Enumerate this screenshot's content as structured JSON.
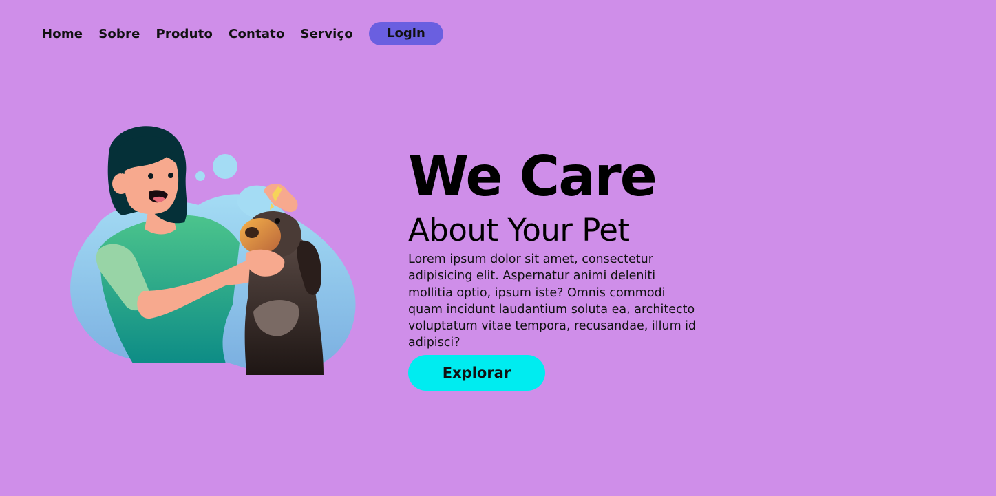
{
  "nav": {
    "links": [
      "Home",
      "Sobre",
      "Produto",
      "Contato",
      "Serviço"
    ],
    "login_label": "Login"
  },
  "hero": {
    "title": "We Care",
    "subtitle": "About Your Pet",
    "description": "Lorem ipsum dolor sit amet, consectetur adipisicing elit. Aspernatur animi deleniti mollitia optio, ipsum iste? Omnis commodi quam incidunt laudantium soluta ea, architecto voluptatum vitae tempora, recusandae, illum id adipisci?",
    "cta_label": "Explorar"
  },
  "colors": {
    "background": "#cf8ee9",
    "login_button": "#6a5fe0",
    "cta_button": "#00ecf0"
  }
}
